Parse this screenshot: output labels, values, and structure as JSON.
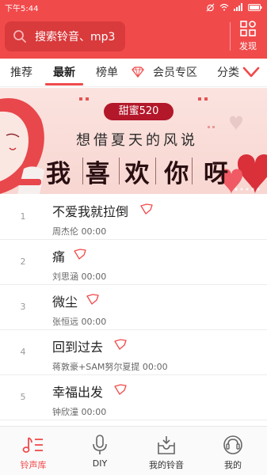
{
  "status_bar": {
    "time": "下午5:44"
  },
  "header": {
    "search_placeholder": "搜索铃音、mp3",
    "discover_label": "发现"
  },
  "tabs": [
    {
      "label": "推荐"
    },
    {
      "label": "最新"
    },
    {
      "label": "榜单"
    },
    {
      "label": "会员专区"
    },
    {
      "label": "分类"
    }
  ],
  "active_tab": "最新",
  "banner": {
    "pill": "甜蜜520",
    "subtitle": "想借夏天的风说",
    "title_chars": [
      "我",
      "喜",
      "欢",
      "你",
      "呀"
    ]
  },
  "songs": [
    {
      "index": "1",
      "title": "不爱我就拉倒",
      "meta": "周杰伦  00:00"
    },
    {
      "index": "2",
      "title": "痛",
      "meta": "刘思涵  00:00"
    },
    {
      "index": "3",
      "title": "微尘",
      "meta": "张恒远  00:00"
    },
    {
      "index": "4",
      "title": "回到过去",
      "meta": "蒋敦豪+SAM努尔夏提  00:00"
    },
    {
      "index": "5",
      "title": "幸福出发",
      "meta": "钟欣潼  00:00"
    }
  ],
  "bottom_nav": [
    {
      "label": "铃声库",
      "icon": "music-note-icon"
    },
    {
      "label": "DIY",
      "icon": "microphone-icon"
    },
    {
      "label": "我的铃音",
      "icon": "inbox-icon"
    },
    {
      "label": "我的",
      "icon": "profile-icon"
    }
  ],
  "active_nav": "铃声库",
  "colors": {
    "accent": "#f14a4b",
    "search_bg": "#d93a3c",
    "banner_pill": "#b3172a"
  }
}
